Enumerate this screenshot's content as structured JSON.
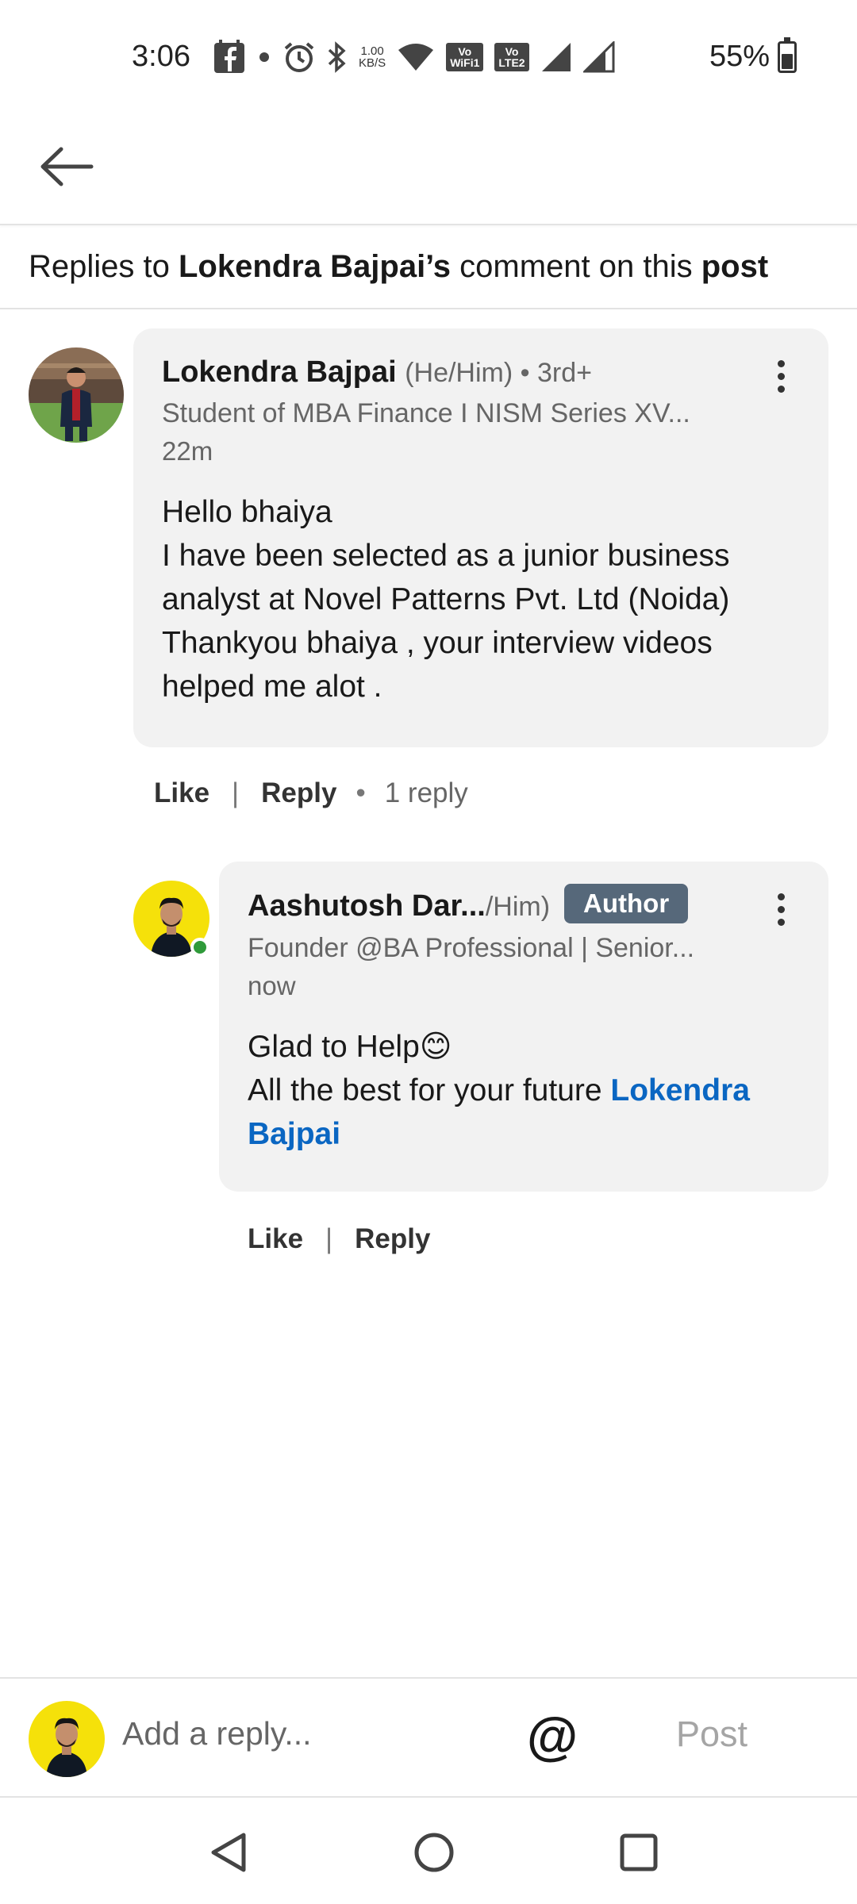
{
  "status_bar": {
    "time": "3:06",
    "net_speed_value": "1.00",
    "net_speed_unit": "KB/S",
    "wifi_badge": "WiFi1",
    "lte_badge": "LTE2",
    "volte_label": "Vo",
    "battery_percent": "55%",
    "battery_level": 0.55
  },
  "header": {
    "prefix": "Replies to ",
    "author": "Lokendra Bajpai’s",
    "middle": " comment on this ",
    "target": "post"
  },
  "comment": {
    "name": "Lokendra Bajpai",
    "meta": "(He/Him) • 3rd+",
    "headline": "Student of MBA Finance I NISM Series XV...",
    "time": "22m",
    "lines": [
      "Hello bhaiya",
      "I have been selected as a junior business",
      "analyst at Novel Patterns Pvt. Ltd (Noida)",
      "Thankyou bhaiya , your interview videos",
      "helped me alot ."
    ],
    "actions": {
      "like": "Like",
      "separator": "|",
      "reply": "Reply",
      "dot": "•",
      "reply_count": "1 reply"
    }
  },
  "reply": {
    "name": "Aashutosh Dar...",
    "meta": "/Him)",
    "badge": "Author",
    "headline": "Founder @BA Professional | Senior...",
    "time": "now",
    "line1": "Glad to Help😊",
    "line2_prefix": "All the best for your future ",
    "mention_first": "Lokendra",
    "mention_second": "Bajpai",
    "online_color": "#2f9a3a",
    "actions": {
      "like": "Like",
      "separator": "|",
      "reply": "Reply"
    }
  },
  "composer": {
    "placeholder": "Add a reply...",
    "at_symbol": "@",
    "post_label": "Post"
  },
  "colors": {
    "mention": "#0a66c2",
    "badge_bg": "#56687a",
    "bubble_bg": "#f2f2f2",
    "avatar_yellow": "#f5e10a"
  },
  "icons": {
    "back": "arrow-left-icon",
    "more": "more-vertical-icon",
    "nav_back": "triangle-back-icon",
    "nav_home": "circle-home-icon",
    "nav_recents": "square-recents-icon"
  }
}
